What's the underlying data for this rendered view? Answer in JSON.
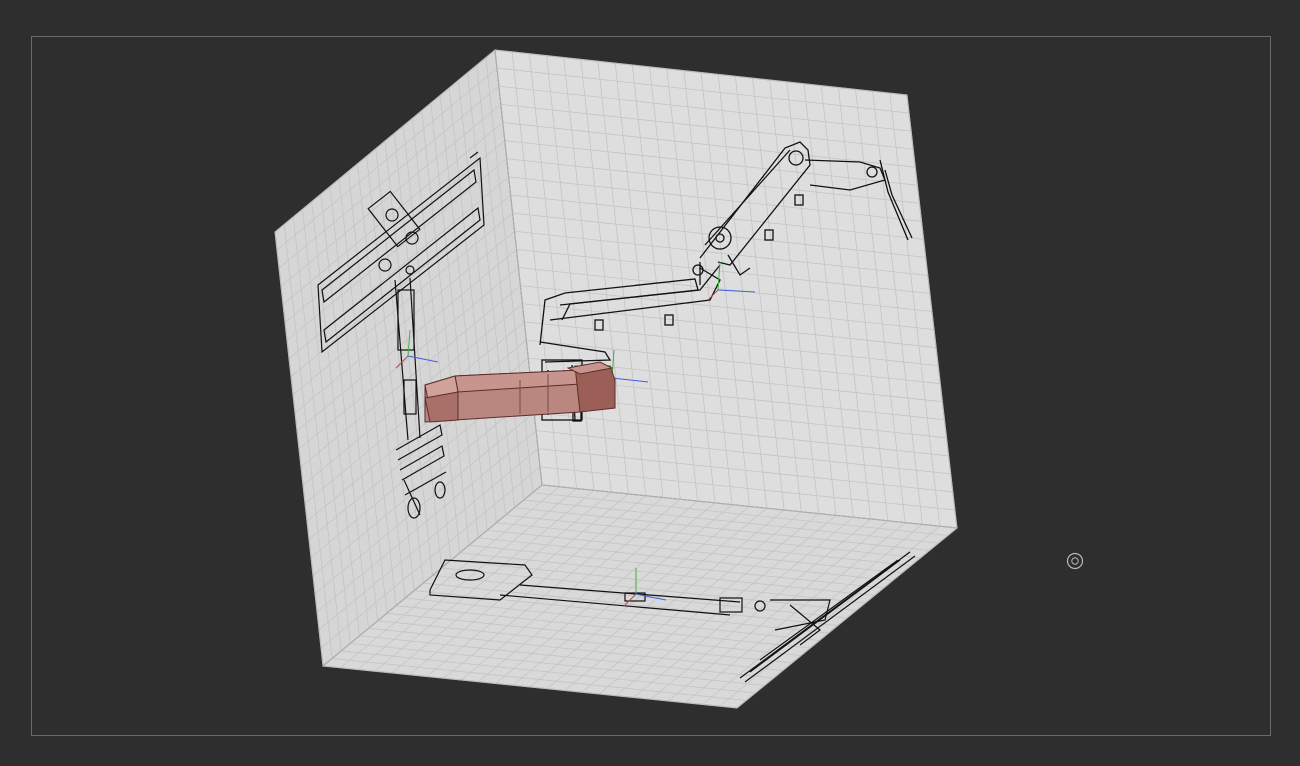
{
  "viewport": {
    "title": "",
    "background": "#2e2e2e",
    "frame_color": "#6a6a6a",
    "grid_color": "#c4c4c4",
    "face_color": "#dcdcdc",
    "part_color": "#b77a74",
    "axis_colors": {
      "x": "#d04040",
      "y": "#40b040",
      "z": "#4060e0"
    }
  },
  "icons": {
    "pivot": "orbit-pivot-icon"
  }
}
